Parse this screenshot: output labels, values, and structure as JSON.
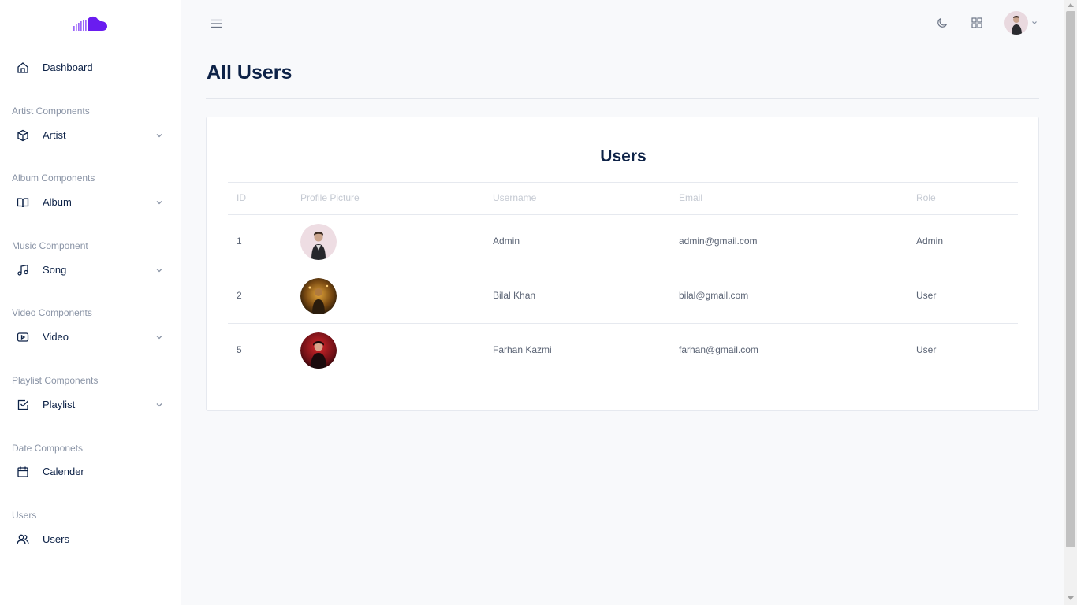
{
  "sidebar": {
    "dashboard": "Dashboard",
    "sections": [
      {
        "title": "Artist Components",
        "item": "Artist"
      },
      {
        "title": "Album Components",
        "item": "Album"
      },
      {
        "title": "Music Component",
        "item": "Song"
      },
      {
        "title": "Video Components",
        "item": "Video"
      },
      {
        "title": "Playlist Components",
        "item": "Playlist"
      },
      {
        "title": "Date Componets",
        "item": "Calender"
      },
      {
        "title": "Users",
        "item": "Users"
      }
    ]
  },
  "page": {
    "title": "All Users"
  },
  "card": {
    "title": "Users",
    "columns": [
      "ID",
      "Profile Picture",
      "Username",
      "Email",
      "Role"
    ],
    "rows": [
      {
        "id": "1",
        "username": "Admin",
        "email": "admin@gmail.com",
        "role": "Admin"
      },
      {
        "id": "2",
        "username": "Bilal Khan",
        "email": "bilal@gmail.com",
        "role": "User"
      },
      {
        "id": "5",
        "username": "Farhan Kazmi",
        "email": "farhan@gmail.com",
        "role": "User"
      }
    ]
  },
  "icons": {
    "logo": "soundcloud-icon",
    "menu": "hamburger-menu-icon",
    "theme": "moon-icon",
    "apps": "grid-icon"
  },
  "colors": {
    "accent": "#7b2ff7",
    "text": "#0d2247",
    "muted": "#8a94a6"
  }
}
